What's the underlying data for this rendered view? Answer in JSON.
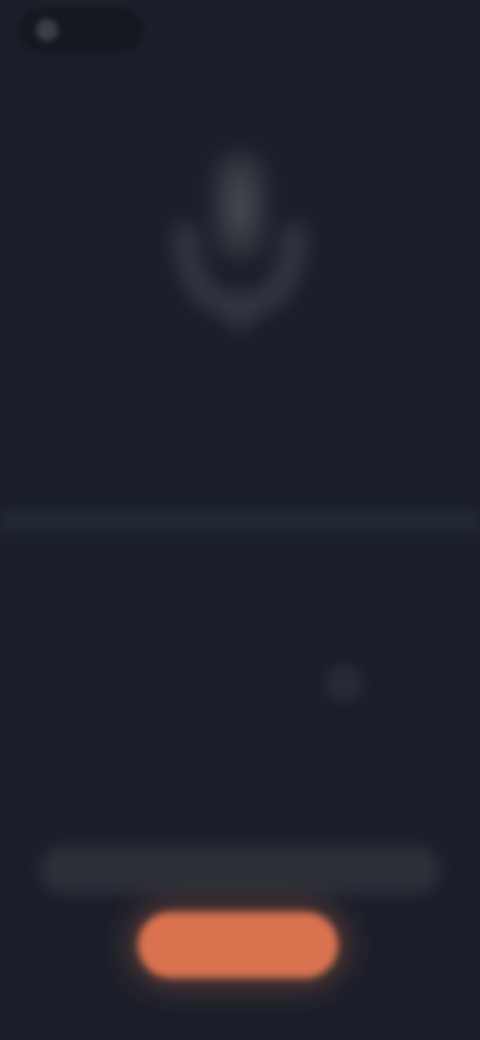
{
  "top_bar": {
    "pill_label": ""
  },
  "mic": {
    "icon": "microphone-icon"
  },
  "status": {
    "line": "",
    "sub": ""
  },
  "caption": {
    "text": ""
  },
  "action": {
    "label": ""
  },
  "colors": {
    "background": "#1b1f2a",
    "accent": "#d9734f"
  }
}
